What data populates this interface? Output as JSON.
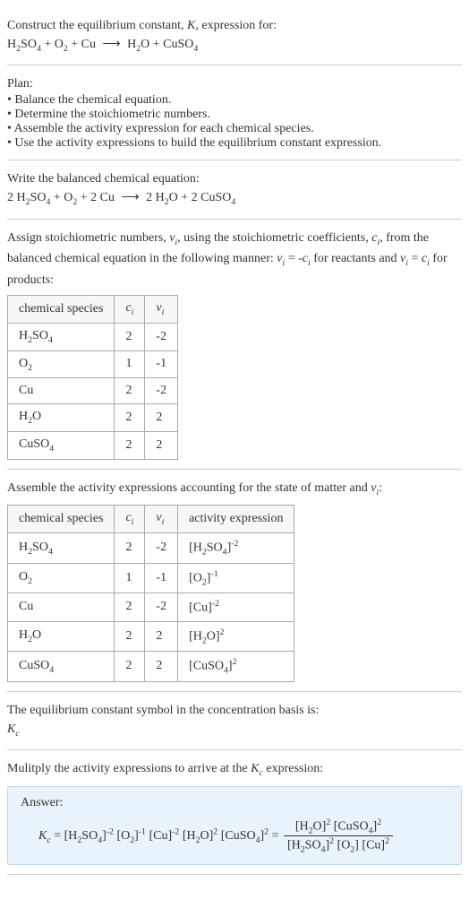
{
  "header": {
    "line1": "Construct the equilibrium constant, K, expression for:",
    "equation_text": "H₂SO₄ + O₂ + Cu ⟶ H₂O + CuSO₄"
  },
  "plan": {
    "title": "Plan:",
    "items": [
      "Balance the chemical equation.",
      "Determine the stoichiometric numbers.",
      "Assemble the activity expression for each chemical species.",
      "Use the activity expressions to build the equilibrium constant expression."
    ]
  },
  "balanced": {
    "title": "Write the balanced chemical equation:",
    "equation_text": "2 H₂SO₄ + O₂ + 2 Cu ⟶ 2 H₂O + 2 CuSO₄"
  },
  "stoich": {
    "intro": "Assign stoichiometric numbers, νᵢ, using the stoichiometric coefficients, cᵢ, from the balanced chemical equation in the following manner: νᵢ = -cᵢ for reactants and νᵢ = cᵢ for products:",
    "headers": {
      "species": "chemical species",
      "ci": "cᵢ",
      "vi": "νᵢ"
    },
    "rows": [
      {
        "species": "H₂SO₄",
        "ci": "2",
        "vi": "-2"
      },
      {
        "species": "O₂",
        "ci": "1",
        "vi": "-1"
      },
      {
        "species": "Cu",
        "ci": "2",
        "vi": "-2"
      },
      {
        "species": "H₂O",
        "ci": "2",
        "vi": "2"
      },
      {
        "species": "CuSO₄",
        "ci": "2",
        "vi": "2"
      }
    ]
  },
  "activity": {
    "intro": "Assemble the activity expressions accounting for the state of matter and νᵢ:",
    "headers": {
      "species": "chemical species",
      "ci": "cᵢ",
      "vi": "νᵢ",
      "expr": "activity expression"
    },
    "rows": [
      {
        "species": "H₂SO₄",
        "ci": "2",
        "vi": "-2",
        "expr_base": "[H₂SO₄]",
        "expr_sup": "-2"
      },
      {
        "species": "O₂",
        "ci": "1",
        "vi": "-1",
        "expr_base": "[O₂]",
        "expr_sup": "-1"
      },
      {
        "species": "Cu",
        "ci": "2",
        "vi": "-2",
        "expr_base": "[Cu]",
        "expr_sup": "-2"
      },
      {
        "species": "H₂O",
        "ci": "2",
        "vi": "2",
        "expr_base": "[H₂O]",
        "expr_sup": "2"
      },
      {
        "species": "CuSO₄",
        "ci": "2",
        "vi": "2",
        "expr_base": "[CuSO₄]",
        "expr_sup": "2"
      }
    ]
  },
  "symbol": {
    "line1": "The equilibrium constant symbol in the concentration basis is:",
    "line2": "K_c"
  },
  "multiply": {
    "intro": "Mulitply the activity expressions to arrive at the K_c expression:"
  },
  "answer": {
    "label": "Answer:",
    "kc": "K_c",
    "terms": [
      {
        "base": "[H₂SO₄]",
        "sup": "-2"
      },
      {
        "base": "[O₂]",
        "sup": "-1"
      },
      {
        "base": "[Cu]",
        "sup": "-2"
      },
      {
        "base": "[H₂O]",
        "sup": "2"
      },
      {
        "base": "[CuSO₄]",
        "sup": "2"
      }
    ],
    "num": [
      {
        "base": "[H₂O]",
        "sup": "2"
      },
      {
        "base": "[CuSO₄]",
        "sup": "2"
      }
    ],
    "den": [
      {
        "base": "[H₂SO₄]",
        "sup": "2"
      },
      {
        "base": "[O₂]",
        "sup": ""
      },
      {
        "base": "[Cu]",
        "sup": "2"
      }
    ]
  }
}
